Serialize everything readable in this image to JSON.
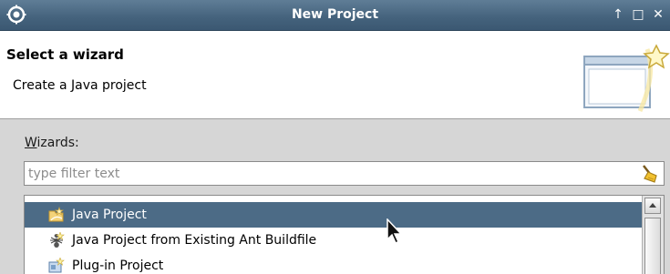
{
  "window": {
    "title": "New Project",
    "controls": [
      "↑",
      "□",
      "✕"
    ]
  },
  "header": {
    "title": "Select a wizard",
    "description": "Create a Java project"
  },
  "wizards": {
    "label_mnemonic": "W",
    "label_rest": "izards:",
    "filter_placeholder": "type filter text",
    "items": [
      {
        "label": "Java Project",
        "icon": "java-project-icon",
        "selected": true
      },
      {
        "label": "Java Project from Existing Ant Buildfile",
        "icon": "ant-icon",
        "selected": false
      },
      {
        "label": "Plug-in Project",
        "icon": "plugin-project-icon",
        "selected": false
      }
    ]
  },
  "colors": {
    "titlebar": "#44627c",
    "selection": "#4c6b86"
  }
}
